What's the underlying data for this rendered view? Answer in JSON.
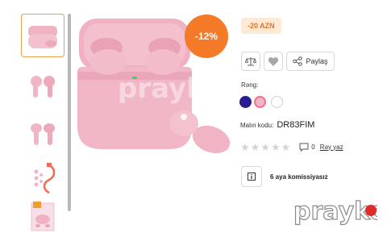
{
  "product": {
    "discount_badge": "-12%",
    "discount_amount": "-20 AZN",
    "share_label": "Paylaş",
    "color_label": "Rəng:",
    "code_label": "Malın kodu:",
    "code_value": "DR83FIM",
    "rating_stars": 0,
    "comment_count": "0",
    "review_link": "Rəy yaz",
    "installment_text": "6 aya komissiyasız",
    "colors": [
      "#2a1d93",
      "#f0b7c7",
      "#ffffff"
    ],
    "selected_color": "#f0b7c7"
  },
  "thumbnails": [
    {
      "name": "earbuds-case-open",
      "active": true
    },
    {
      "name": "earbuds-pair"
    },
    {
      "name": "earbuds-side"
    },
    {
      "name": "usb-cable-and-tips"
    },
    {
      "name": "retail-box"
    }
  ],
  "watermark": {
    "brand": "prayko"
  },
  "colors": {
    "accent": "#f47a28",
    "accent_soft": "#fde9d4",
    "product_pink": "#f2b8c6"
  }
}
